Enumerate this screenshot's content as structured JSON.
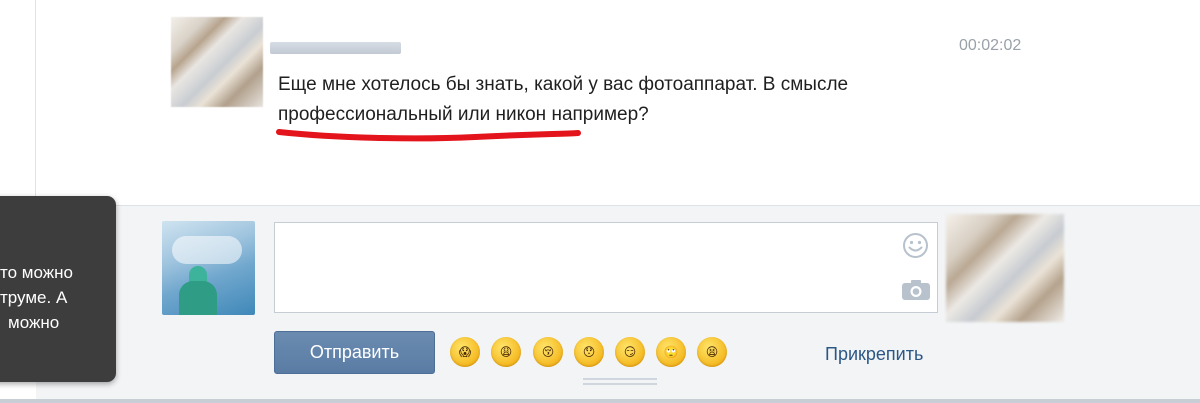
{
  "message": {
    "time": "00:02:02",
    "text": "Еще мне хотелось бы знать, какой у вас фотоаппарат. В смысле профессиональный или никон например?"
  },
  "tooltip": {
    "lines": [
      "то можно",
      "труме. А",
      "можно"
    ]
  },
  "compose": {
    "input_value": "",
    "send_label": "Отправить",
    "attach_label": "Прикрепить",
    "emojis": [
      {
        "name": "scream-emoji",
        "glyph": "😱"
      },
      {
        "name": "weary-emoji",
        "glyph": "😩"
      },
      {
        "name": "kiss-emoji",
        "glyph": "😚"
      },
      {
        "name": "surprised-emoji",
        "glyph": "😯"
      },
      {
        "name": "smirk-emoji",
        "glyph": "😏"
      },
      {
        "name": "rolling-eyes-emoji",
        "glyph": "🙄"
      },
      {
        "name": "tired-emoji",
        "glyph": "😫"
      }
    ]
  },
  "colors": {
    "send_button": "#5a7ca4",
    "link": "#2b5785",
    "underline": "#e3141b",
    "compose_bg": "#f2f4f6"
  }
}
